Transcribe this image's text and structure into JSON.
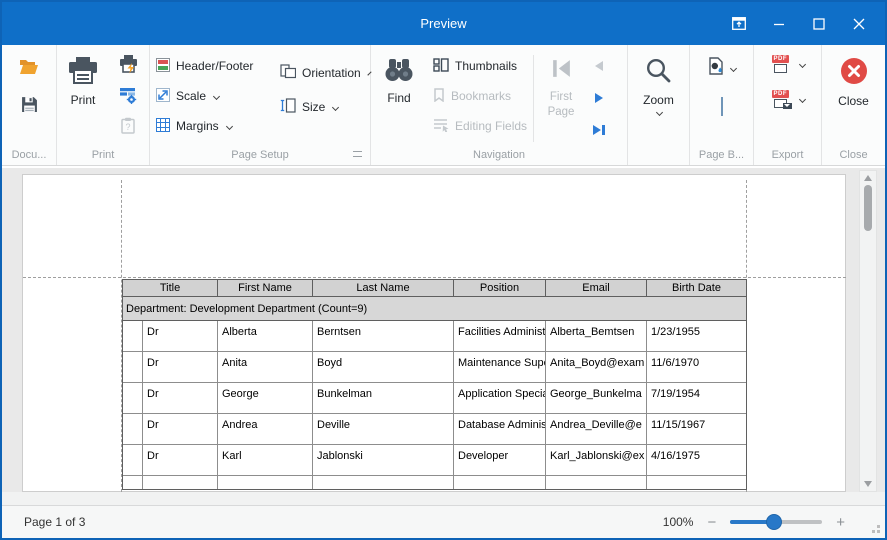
{
  "titlebar": {
    "title": "Preview"
  },
  "ribbon": {
    "document": {
      "label": "Docu..."
    },
    "print": {
      "label": "Print",
      "print_button": "Print"
    },
    "page_setup": {
      "label": "Page Setup",
      "header_footer": "Header/Footer",
      "scale": "Scale",
      "margins": "Margins",
      "orientation": "Orientation",
      "size": "Size"
    },
    "navigation": {
      "label": "Navigation",
      "find": "Find",
      "thumbnails": "Thumbnails",
      "bookmarks": "Bookmarks",
      "editing_fields": "Editing Fields",
      "first_page": "First Page"
    },
    "zoom_group": {
      "label": "",
      "zoom_button": "Zoom"
    },
    "page_background": {
      "label": "Page B..."
    },
    "export": {
      "label": "Export"
    },
    "close": {
      "label": "Close",
      "close_button": "Close"
    }
  },
  "preview": {
    "report": {
      "columns": [
        "Title",
        "First Name",
        "Last Name",
        "Position",
        "Email",
        "Birth Date"
      ],
      "group_row": "Department: Development Department (Count=9)",
      "rows": [
        [
          "Dr",
          "Alberta",
          "Berntsen",
          "Facilities Administr",
          "Alberta_Bemtsen",
          "1/23/1955"
        ],
        [
          "Dr",
          "Anita",
          "Boyd",
          "Maintenance Supe",
          "Anita_Boyd@exam",
          "11/6/1970"
        ],
        [
          "Dr",
          "George",
          "Bunkelman",
          "Application Special",
          "George_Bunkelma",
          "7/19/1954"
        ],
        [
          "Dr",
          "Andrea",
          "Deville",
          "Database Administ",
          "Andrea_Deville@e",
          "11/15/1967"
        ],
        [
          "Dr",
          "Karl",
          "Jablonski",
          "Developer",
          "Karl_Jablonski@ex",
          "4/16/1975"
        ]
      ]
    }
  },
  "statusbar": {
    "page_info": "Page 1 of 3",
    "zoom_level": "100%",
    "minus": "−",
    "plus": "+"
  },
  "icons": {
    "pdf_badge": "PDF",
    "clipboard_question": "?"
  },
  "colors": {
    "titlebar_blue": "#0f6fc8",
    "accent_blue": "#2e7cd6",
    "close_red": "#e04a45",
    "folder_orange": "#f0a32f",
    "pdf_red": "#e25050"
  }
}
